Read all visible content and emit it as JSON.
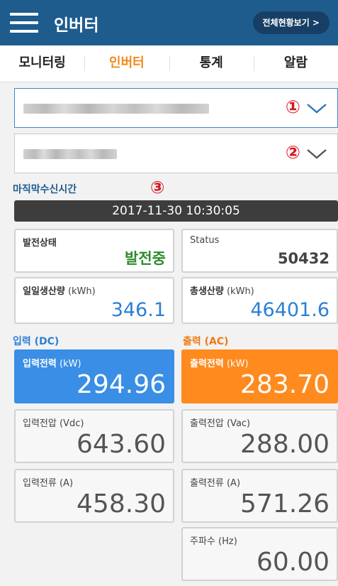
{
  "header": {
    "title": "인버터",
    "overview_button": "전체현황보기 >"
  },
  "tabs": [
    {
      "label": "모니터링"
    },
    {
      "label": "인버터"
    },
    {
      "label": "통계"
    },
    {
      "label": "알람"
    }
  ],
  "active_tab": "인버터",
  "markers": {
    "one": "①",
    "two": "②",
    "three": "③"
  },
  "last_received": {
    "label": "마직막수신시간",
    "datetime": "2017-11-30 10:30:05"
  },
  "status": {
    "generation_label": "발전상태",
    "generation_value": "발전중",
    "status_label": "Status",
    "status_value": "50432"
  },
  "energy": {
    "daily_label": "일일생산량",
    "daily_unit": "(kWh)",
    "daily_value": "346.1",
    "total_label": "총생산량",
    "total_unit": "(kWh)",
    "total_value": "46401.6"
  },
  "input": {
    "section_label": "입력 (DC)",
    "power_label": "입력전력",
    "power_unit": "(kW)",
    "power_value": "294.96",
    "voltage_label": "입력전압",
    "voltage_unit": "(Vdc)",
    "voltage_value": "643.60",
    "current_label": "입력전류",
    "current_unit": "(A)",
    "current_value": "458.30"
  },
  "output": {
    "section_label": "출력 (AC)",
    "power_label": "출력전력",
    "power_unit": "(kW)",
    "power_value": "283.70",
    "voltage_label": "출력전압",
    "voltage_unit": "(Vac)",
    "voltage_value": "288.00",
    "current_label": "출력전류",
    "current_unit": "(A)",
    "current_value": "571.26",
    "frequency_label": "주파수",
    "frequency_unit": "(Hz)",
    "frequency_value": "60.00"
  },
  "colors": {
    "header": "#1e5c8e",
    "active_tab": "#f08a1c",
    "input_accent": "#3a8ee5",
    "output_accent": "#ff8a1e",
    "generating": "#2e8b2e",
    "energy_value": "#2c7fd6"
  },
  "icons": {
    "menu": "hamburger-menu-icon",
    "dropdown": "chevron-down-icon"
  }
}
